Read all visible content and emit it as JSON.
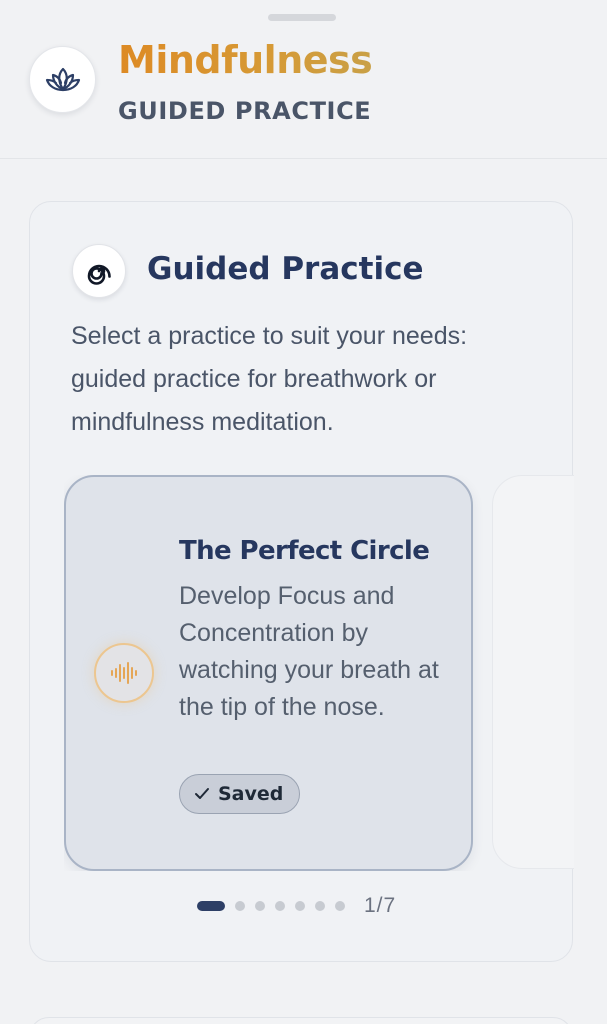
{
  "header": {
    "title": "Mindfulness",
    "subtitle": "GUIDED PRACTICE",
    "icon": "lotus-icon"
  },
  "section": {
    "title": "Guided Practice",
    "icon": "spiral-icon",
    "description": "Select a practice to suit your needs: guided practice for breathwork or mindfulness meditation."
  },
  "carousel": {
    "current": {
      "title": "The Perfect Circle",
      "description": "Develop Focus and Concentration by watching your breath at the tip of the nose.",
      "icon": "audio-wave-icon",
      "saved_label": "Saved",
      "saved_icon": "checkmark-icon"
    },
    "page_count": "1/7",
    "active_index": 1,
    "total": 7
  },
  "colors": {
    "accent_orange": "#dd8a24",
    "navy": "#26375f",
    "text_gray": "#4a5568"
  }
}
